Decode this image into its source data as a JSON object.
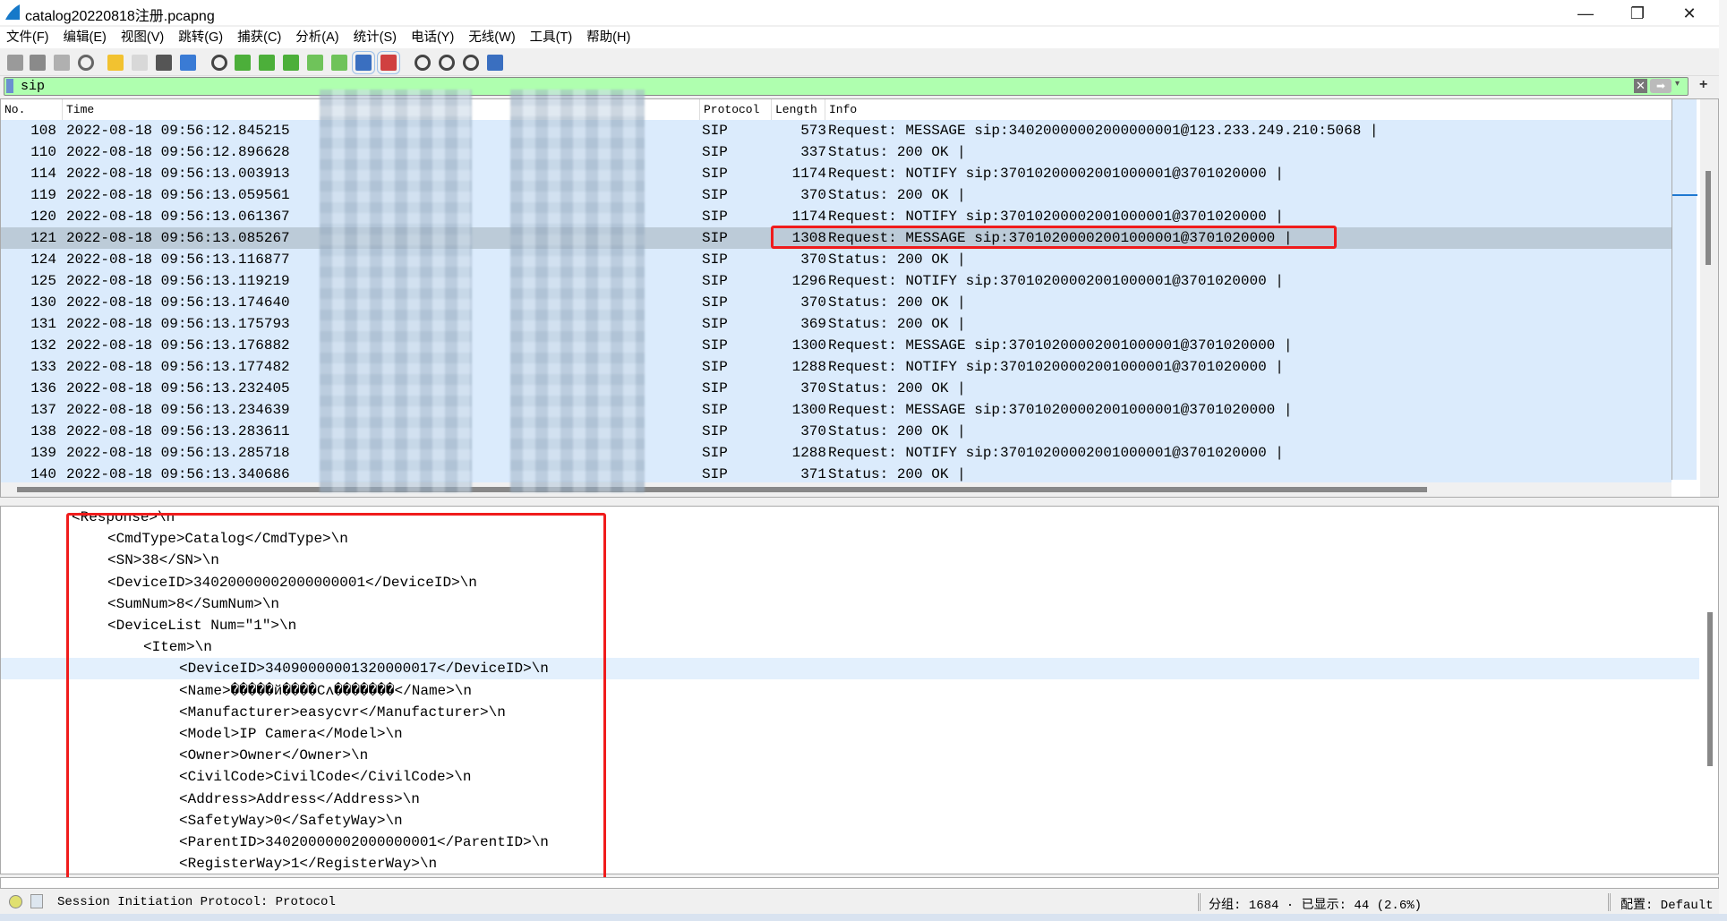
{
  "window": {
    "title": "catalog20220818注册.pcapng",
    "minimize": "—",
    "restore": "❐",
    "close": "✕"
  },
  "menu": [
    "文件(F)",
    "编辑(E)",
    "视图(V)",
    "跳转(G)",
    "捕获(C)",
    "分析(A)",
    "统计(S)",
    "电话(Y)",
    "无线(W)",
    "工具(T)",
    "帮助(H)"
  ],
  "toolbar_icons": [
    {
      "name": "start-capture-icon",
      "color": "#9a9a9a"
    },
    {
      "name": "stop-capture-icon",
      "color": "#8a8a8a"
    },
    {
      "name": "restart-capture-icon",
      "color": "#b0b0b0"
    },
    {
      "name": "capture-options-icon",
      "color": "#666666"
    },
    {
      "name": "open-file-icon",
      "color": "#f2c230"
    },
    {
      "name": "save-file-icon",
      "color": "#d8d8d8"
    },
    {
      "name": "close-file-icon",
      "color": "#555555"
    },
    {
      "name": "reload-icon",
      "color": "#3a7bd5"
    },
    {
      "name": "find-packet-icon",
      "color": "#444444"
    },
    {
      "name": "go-back-icon",
      "color": "#4caf3a"
    },
    {
      "name": "go-forward-icon",
      "color": "#4caf3a"
    },
    {
      "name": "go-to-packet-icon",
      "color": "#4caf3a"
    },
    {
      "name": "go-first-icon",
      "color": "#6fc35a"
    },
    {
      "name": "go-last-icon",
      "color": "#6fc35a"
    },
    {
      "name": "autoscroll-icon",
      "color": "#3a6fc0"
    },
    {
      "name": "colorize-icon",
      "color": "#d04040"
    },
    {
      "name": "zoom-in-icon",
      "color": "#444444"
    },
    {
      "name": "zoom-out-icon",
      "color": "#444444"
    },
    {
      "name": "zoom-reset-icon",
      "color": "#444444"
    },
    {
      "name": "resize-columns-icon",
      "color": "#3a6fc0"
    }
  ],
  "filter": {
    "value": "sip",
    "clear": "✕",
    "apply": "➡",
    "dropdown": "▾",
    "add": "+"
  },
  "columns": {
    "no": "No.",
    "time": "Time",
    "protocol": "Protocol",
    "length": "Length",
    "info": "Info"
  },
  "packets": [
    {
      "no": "108",
      "time": "2022-08-18 09:56:12.845215",
      "protocol": "SIP",
      "length": "573",
      "info": "Request: MESSAGE sip:34020000002000000001@123.233.249.210:5068 |"
    },
    {
      "no": "110",
      "time": "2022-08-18 09:56:12.896628",
      "protocol": "SIP",
      "length": "337",
      "info": "Status: 200 OK |"
    },
    {
      "no": "114",
      "time": "2022-08-18 09:56:13.003913",
      "protocol": "SIP",
      "length": "1174",
      "info": "Request: NOTIFY sip:37010200002001000001@3701020000 |"
    },
    {
      "no": "119",
      "time": "2022-08-18 09:56:13.059561",
      "protocol": "SIP",
      "length": "370",
      "info": "Status: 200 OK |"
    },
    {
      "no": "120",
      "time": "2022-08-18 09:56:13.061367",
      "protocol": "SIP",
      "length": "1174",
      "info": "Request: NOTIFY sip:37010200002001000001@3701020000 |"
    },
    {
      "no": "121",
      "time": "2022-08-18 09:56:13.085267",
      "protocol": "SIP",
      "length": "1308",
      "info": "Request: MESSAGE sip:37010200002001000001@3701020000 |",
      "selected": true
    },
    {
      "no": "124",
      "time": "2022-08-18 09:56:13.116877",
      "protocol": "SIP",
      "length": "370",
      "info": "Status: 200 OK |"
    },
    {
      "no": "125",
      "time": "2022-08-18 09:56:13.119219",
      "protocol": "SIP",
      "length": "1296",
      "info": "Request: NOTIFY sip:37010200002001000001@3701020000 |"
    },
    {
      "no": "130",
      "time": "2022-08-18 09:56:13.174640",
      "protocol": "SIP",
      "length": "370",
      "info": "Status: 200 OK |"
    },
    {
      "no": "131",
      "time": "2022-08-18 09:56:13.175793",
      "protocol": "SIP",
      "length": "369",
      "info": "Status: 200 OK |"
    },
    {
      "no": "132",
      "time": "2022-08-18 09:56:13.176882",
      "protocol": "SIP",
      "length": "1300",
      "info": "Request: MESSAGE sip:37010200002001000001@3701020000 |"
    },
    {
      "no": "133",
      "time": "2022-08-18 09:56:13.177482",
      "protocol": "SIP",
      "length": "1288",
      "info": "Request: NOTIFY sip:37010200002001000001@3701020000 |"
    },
    {
      "no": "136",
      "time": "2022-08-18 09:56:13.232405",
      "protocol": "SIP",
      "length": "370",
      "info": "Status: 200 OK |"
    },
    {
      "no": "137",
      "time": "2022-08-18 09:56:13.234639",
      "protocol": "SIP",
      "length": "1300",
      "info": "Request: MESSAGE sip:37010200002001000001@3701020000 |"
    },
    {
      "no": "138",
      "time": "2022-08-18 09:56:13.283611",
      "protocol": "SIP",
      "length": "370",
      "info": "Status: 200 OK |"
    },
    {
      "no": "139",
      "time": "2022-08-18 09:56:13.285718",
      "protocol": "SIP",
      "length": "1288",
      "info": "Request: NOTIFY sip:37010200002001000001@3701020000 |"
    },
    {
      "no": "140",
      "time": "2022-08-18 09:56:13.340686",
      "protocol": "SIP",
      "length": "371",
      "info": "Status: 200 OK |"
    }
  ],
  "detail_lines": [
    {
      "level": 0,
      "text": "<Response>\\n"
    },
    {
      "level": 1,
      "text": "<CmdType>Catalog</CmdType>\\n"
    },
    {
      "level": 1,
      "text": "<SN>38</SN>\\n"
    },
    {
      "level": 1,
      "text": "<DeviceID>34020000002000000001</DeviceID>\\n"
    },
    {
      "level": 1,
      "text": "<SumNum>8</SumNum>\\n"
    },
    {
      "level": 1,
      "text": "<DeviceList Num=\"1\">\\n"
    },
    {
      "level": 2,
      "text": "<Item>\\n"
    },
    {
      "level": 3,
      "text": "<DeviceID>34090000001320000017</DeviceID>\\n",
      "highlight": true
    },
    {
      "level": 3,
      "text": "<Name>�����й����Cʌ�������</Name>\\n"
    },
    {
      "level": 3,
      "text": "<Manufacturer>easycvr</Manufacturer>\\n"
    },
    {
      "level": 3,
      "text": "<Model>IP Camera</Model>\\n"
    },
    {
      "level": 3,
      "text": "<Owner>Owner</Owner>\\n"
    },
    {
      "level": 3,
      "text": "<CivilCode>CivilCode</CivilCode>\\n"
    },
    {
      "level": 3,
      "text": "<Address>Address</Address>\\n"
    },
    {
      "level": 3,
      "text": "<SafetyWay>0</SafetyWay>\\n"
    },
    {
      "level": 3,
      "text": "<ParentID>34020000002000000001</ParentID>\\n"
    },
    {
      "level": 3,
      "text": "<RegisterWay>1</RegisterWay>\\n"
    }
  ],
  "status": {
    "field": "Session Initiation Protocol: Protocol",
    "packets": "分组: 1684 · 已显示: 44 (2.6%)",
    "profile": "配置: Default"
  }
}
